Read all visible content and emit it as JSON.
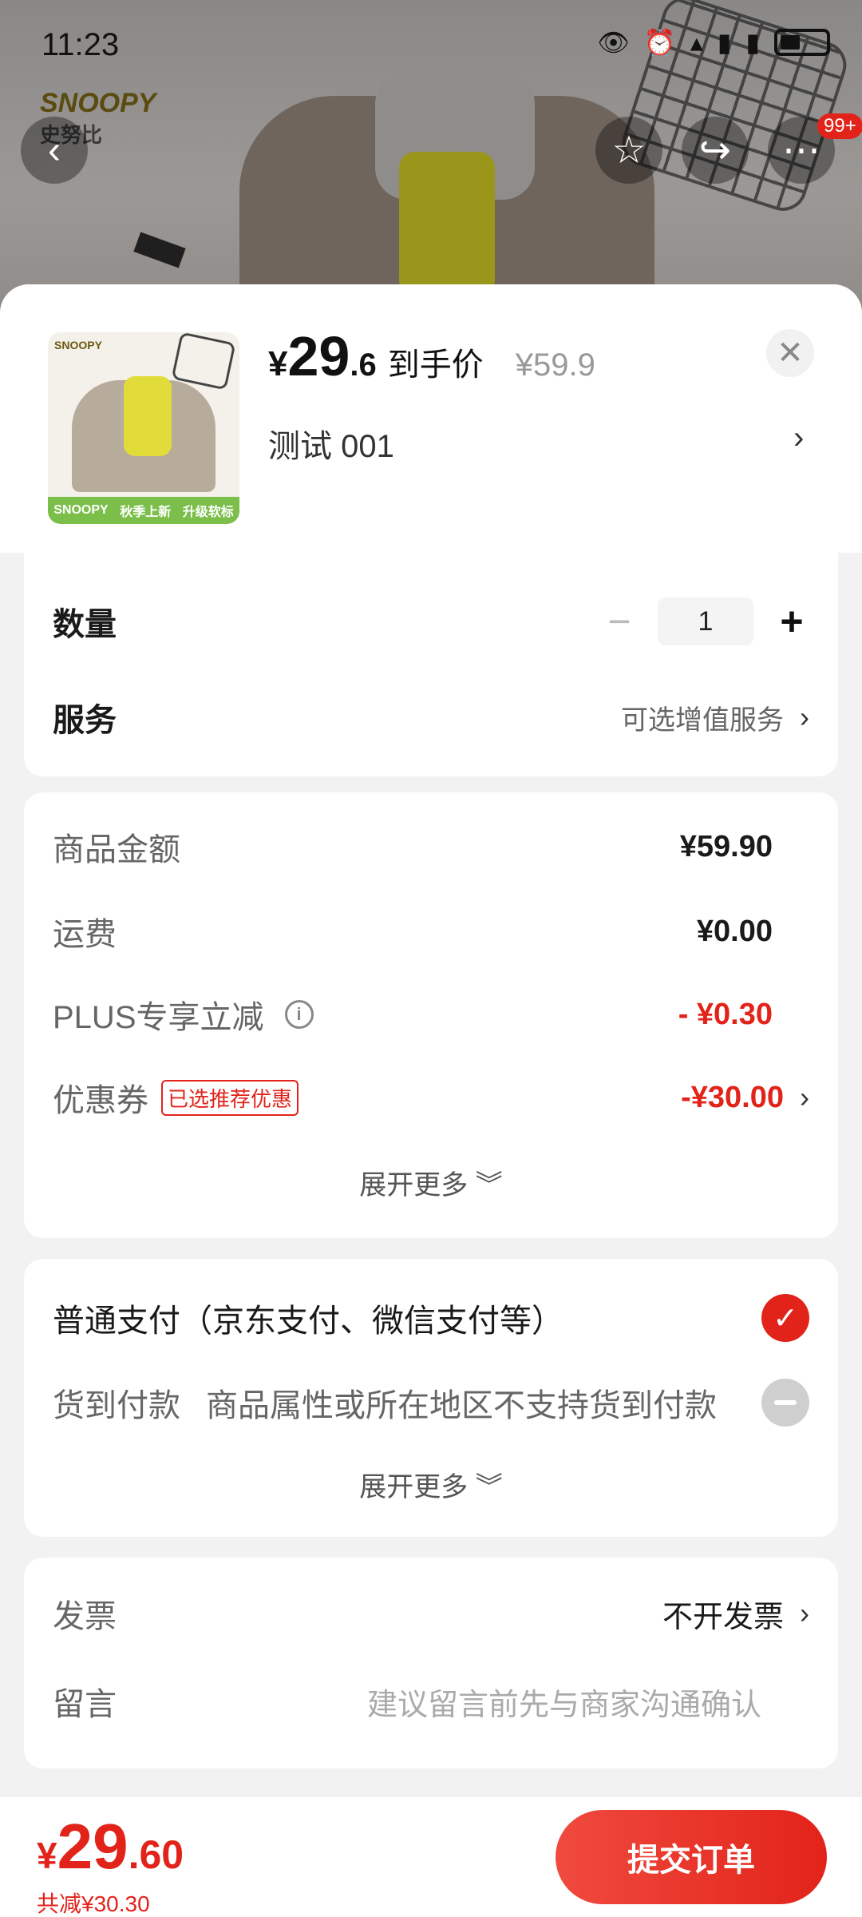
{
  "status_bar": {
    "time": "11:23"
  },
  "background": {
    "brand": "SNOOPY",
    "brand_cn": "史努比"
  },
  "nav": {
    "more_badge": "99+"
  },
  "product": {
    "currency": "¥",
    "price_int": "29",
    "price_dec": ".6",
    "price_label": "到手价",
    "original_price": "¥59.9",
    "spec": "测试  001",
    "thumb_brand": "SNOOPY",
    "thumb_banner_1": "秋季上新",
    "thumb_banner_2": "升级软标"
  },
  "quantity": {
    "label": "数量",
    "value": "1"
  },
  "service": {
    "label": "服务",
    "value": "可选增值服务"
  },
  "summary": {
    "goods_label": "商品金额",
    "goods_value": "¥59.90",
    "shipping_label": "运费",
    "shipping_value": "¥0.00",
    "plus_label": "PLUS专享立减",
    "plus_value": "- ¥0.30",
    "coupon_label": "优惠券",
    "coupon_tag": "已选推荐优惠",
    "coupon_value": "-¥30.00",
    "expand": "展开更多 ︾"
  },
  "payment": {
    "normal_label": "普通支付（京东支付、微信支付等）",
    "cod_label": "货到付款",
    "cod_note": "商品属性或所在地区不支持货到付款",
    "expand": "展开更多 ︾"
  },
  "extra": {
    "invoice_label": "发票",
    "invoice_value": "不开发票",
    "message_label": "留言",
    "message_placeholder": "建议留言前先与商家沟通确认"
  },
  "bottom": {
    "currency": "¥",
    "total_int": "29",
    "total_dec": ".60",
    "saved": "共减¥30.30",
    "submit": "提交订单"
  },
  "colors": {
    "accent": "#e2231a"
  }
}
